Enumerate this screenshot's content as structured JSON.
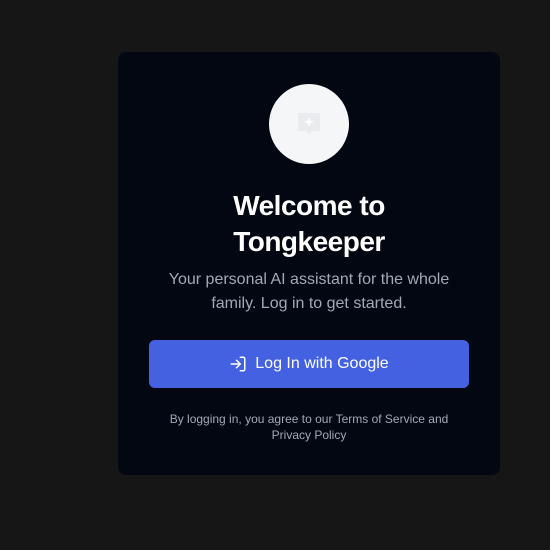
{
  "card": {
    "logo_icon": "chat-bubble-sparkle-icon",
    "title_line1": "Welcome to",
    "title_line2": "Tongkeeper",
    "subtitle_line1": "Your personal AI assistant for the whole",
    "subtitle_line2": "family. Log in to get started.",
    "login_button_label": "Log In with Google",
    "login_button_icon": "log-in-icon",
    "terms_line1": "By logging in, you agree to our Terms of Service and",
    "terms_line2": "Privacy Policy"
  },
  "colors": {
    "page_background": "#161616",
    "card_background": "#030712",
    "accent": "#4361e0",
    "text_primary": "#ffffff",
    "text_muted": "#a3a8b5"
  }
}
